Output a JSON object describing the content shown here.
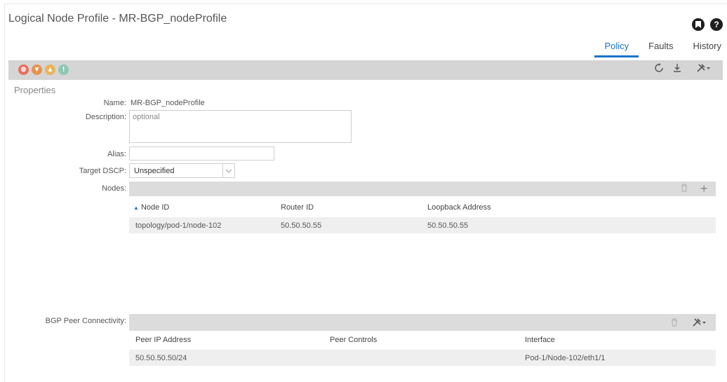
{
  "header": {
    "title": "Logical Node Profile - MR-BGP_nodeProfile",
    "bookmark_icon": "bookmark-icon",
    "help_icon": "help-icon",
    "help_glyph": "?"
  },
  "tabs": [
    {
      "label": "Policy",
      "active": true
    },
    {
      "label": "Faults",
      "active": false
    },
    {
      "label": "History",
      "active": false
    }
  ],
  "toolbar": {
    "fault_icons": [
      {
        "name": "critical-fault-icon",
        "color": "#e86f5d",
        "glyph": "⊗"
      },
      {
        "name": "major-fault-icon",
        "color": "#e8934f",
        "glyph": "▼"
      },
      {
        "name": "minor-fault-icon",
        "color": "#eab55a",
        "glyph": "▲"
      },
      {
        "name": "warning-fault-icon",
        "color": "#8fc7b6",
        "glyph": "!"
      }
    ],
    "refresh_icon": "refresh-icon",
    "download_icon": "download-icon",
    "tools_icon": "tools-icon"
  },
  "properties": {
    "section_label": "Properties",
    "name_label": "Name:",
    "name_value": "MR-BGP_nodeProfile",
    "description_label": "Description:",
    "description_placeholder": "optional",
    "alias_label": "Alias:",
    "alias_value": "",
    "target_dscp_label": "Target DSCP:",
    "target_dscp_value": "Unspecified",
    "nodes_label": "Nodes:",
    "bgp_label": "BGP Peer Connectivity:"
  },
  "nodes_table": {
    "columns": [
      "Node ID",
      "Router ID",
      "Loopback Address"
    ],
    "sort_indicator": "▲",
    "rows": [
      [
        "topology/pod-1/node-102",
        "50.50.50.55",
        "50.50.50.55"
      ]
    ]
  },
  "bgp_table": {
    "columns": [
      "Peer IP Address",
      "Peer Controls",
      "Interface"
    ],
    "rows": [
      [
        "50.50.50.50/24",
        "",
        "Pod-1/Node-102/eth1/1"
      ]
    ]
  },
  "colors": {
    "accent": "#1a73c7",
    "toolbar_bg": "#d5d5d5"
  }
}
